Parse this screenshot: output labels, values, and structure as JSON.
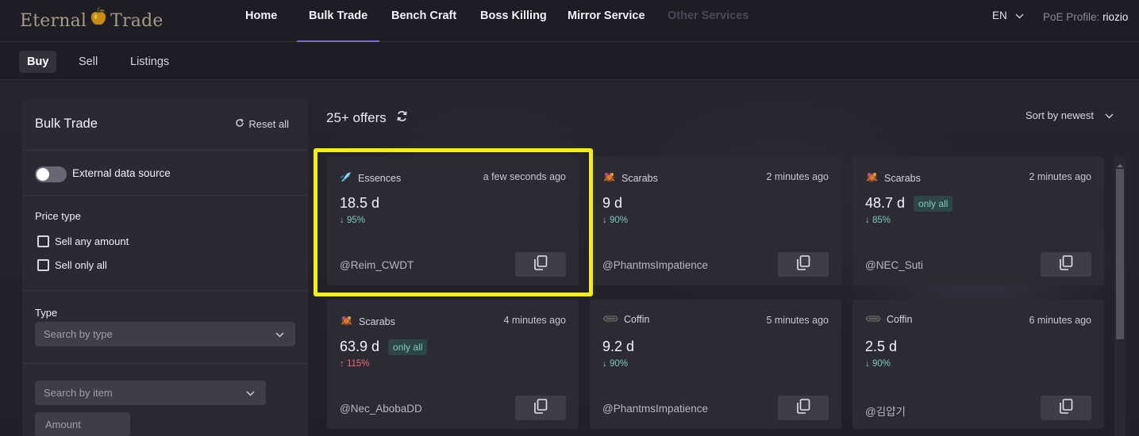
{
  "brand": {
    "left": "Eternal",
    "right": "Trade"
  },
  "nav": [
    {
      "label": "Home"
    },
    {
      "label": "Bulk Trade"
    },
    {
      "label": "Bench Craft"
    },
    {
      "label": "Boss Killing"
    },
    {
      "label": "Mirror Service"
    },
    {
      "label": "Other Services"
    }
  ],
  "nav_active": "Bulk Trade",
  "language": "EN",
  "profile": {
    "label": "PoE Profile:",
    "name": "riozio"
  },
  "subtabs": [
    {
      "label": "Buy"
    },
    {
      "label": "Sell"
    },
    {
      "label": "Listings"
    }
  ],
  "subtab_active": "Buy",
  "filters": {
    "title": "Bulk Trade",
    "reset_label": "Reset all",
    "external_source_label": "External data source",
    "external_source_enabled": false,
    "price_type_label": "Price type",
    "sell_any_label": "Sell any amount",
    "sell_only_all_label": "Sell only all",
    "type_label": "Type",
    "type_placeholder": "Search by type",
    "item_placeholder": "Search by item",
    "amount_placeholder": "Amount"
  },
  "offers": {
    "count_label": "25+ offers",
    "sort_label": "Sort by newest",
    "items": [
      {
        "category": "Essences",
        "icon": "essence-icon",
        "time": "a few seconds ago",
        "price": "18.5 d",
        "badge": "",
        "change": "↓ 95%",
        "direction": "down",
        "seller": "@Reim_CWDT"
      },
      {
        "category": "Scarabs",
        "icon": "scarab-icon",
        "time": "2 minutes ago",
        "price": "9 d",
        "badge": "",
        "change": "↓ 90%",
        "direction": "down",
        "seller": "@PhantmsImpatience"
      },
      {
        "category": "Scarabs",
        "icon": "scarab-icon",
        "time": "2 minutes ago",
        "price": "48.7 d",
        "badge": "only all",
        "change": "↓ 85%",
        "direction": "down",
        "seller": "@NEC_Suti"
      },
      {
        "category": "Scarabs",
        "icon": "scarab-icon",
        "time": "4 minutes ago",
        "price": "63.9 d",
        "badge": "only all",
        "change": "↑ 115%",
        "direction": "up",
        "seller": "@Nec_AbobaDD"
      },
      {
        "category": "Coffin",
        "icon": "coffin-icon",
        "time": "5 minutes ago",
        "price": "9.2 d",
        "badge": "",
        "change": "↓ 90%",
        "direction": "down",
        "seller": "@PhantmsImpatience"
      },
      {
        "category": "Coffin",
        "icon": "coffin-icon",
        "time": "6 minutes ago",
        "price": "2.5 d",
        "badge": "",
        "change": "↓ 90%",
        "direction": "down",
        "seller": "@김얍기"
      }
    ]
  },
  "colors": {
    "accent": "#7b6ad6",
    "highlight": "#f4ef10",
    "change_down": "#7fc9c0",
    "change_up": "#ef6b7b"
  }
}
